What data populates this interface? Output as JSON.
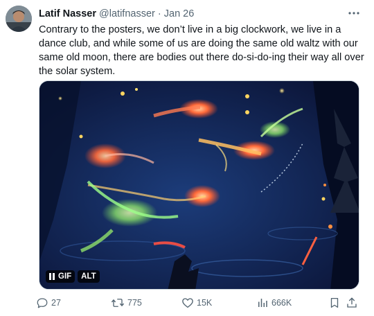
{
  "tweet": {
    "author_name": "Latif Nasser",
    "handle": "@latifnasser",
    "separator": "·",
    "date": "Jan 26",
    "more_icon": "more-horizontal-icon",
    "text": "Contrary to the posters, we don’t live in a big clockwork, we live in a dance club, and while some of us are doing the same old waltz with our same old moon, there are bodies out there do-si-do-ing their way all over the solar system."
  },
  "media": {
    "type": "gif",
    "pause_icon": "pause-icon",
    "gif_label": "GIF",
    "alt_label": "ALT"
  },
  "actions": {
    "replies": "27",
    "reposts": "775",
    "likes": "15K",
    "views": "666K"
  },
  "colors": {
    "text": "#0f1419",
    "secondary": "#536471",
    "border": "#cfd9de"
  }
}
